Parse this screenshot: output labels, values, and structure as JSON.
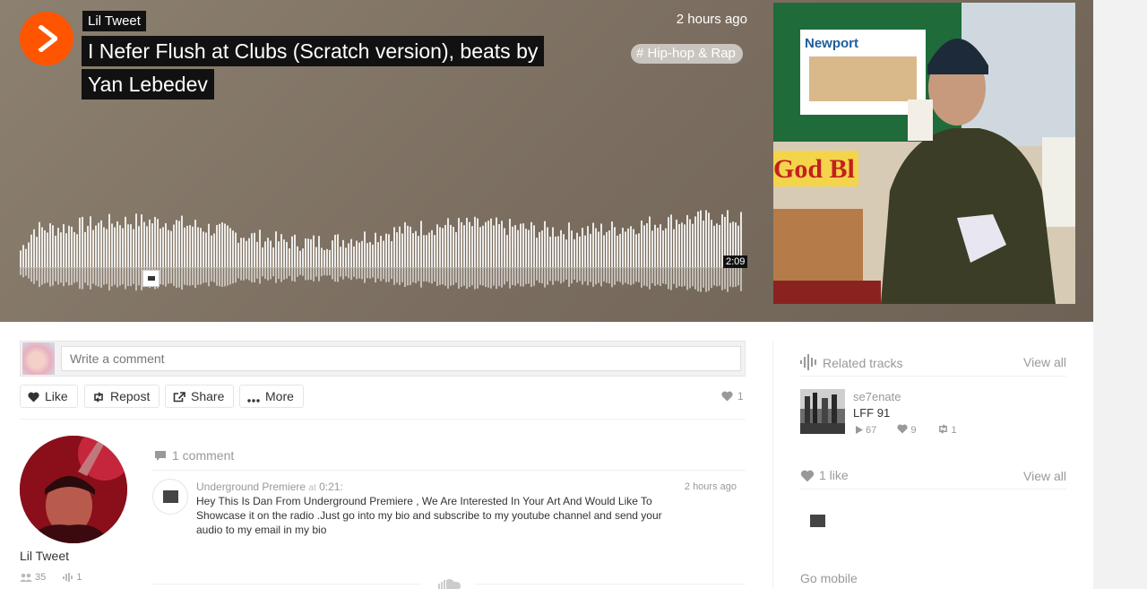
{
  "track": {
    "artist": "Lil Tweet",
    "title_line1": "I Nefer Flush at Clubs (Scratch version), beats by",
    "title_line2": "Yan Lebedev",
    "posted": "2 hours ago",
    "genre": "# Hip-hop & Rap",
    "duration": "2:09"
  },
  "colors": {
    "accent": "#ff5500",
    "hero_bg": "#7d7062"
  },
  "comment_form": {
    "placeholder": "Write a comment"
  },
  "actions": {
    "like": "Like",
    "repost": "Repost",
    "share": "Share",
    "more": "More",
    "like_count": "1"
  },
  "artist": {
    "name": "Lil Tweet",
    "followers": "35",
    "tracks": "1"
  },
  "comments": {
    "count_label": "1 comment",
    "items": [
      {
        "user": "Underground Premiere",
        "at_label": "at",
        "timestamp": "0:21:",
        "posted": "2 hours ago",
        "body": "Hey This Is Dan From Underground Premiere , We Are Interested In Your Art And Would Like To Showcase it on the radio .Just go into my bio and subscribe to my youtube channel and send your audio to my email in my bio"
      }
    ]
  },
  "sidebar": {
    "related_header": "Related tracks",
    "view_all": "View all",
    "related": [
      {
        "user": "se7enate",
        "title": "LFF 91",
        "plays": "67",
        "likes": "9",
        "reposts": "1"
      }
    ],
    "likes_header": "1 like",
    "go_mobile": "Go mobile"
  },
  "icons": [
    "play-icon",
    "heart-icon",
    "repost-icon",
    "share-icon",
    "more-icon",
    "comment-icon",
    "followers-icon",
    "tracks-icon",
    "waveform-icon",
    "soundcloud-icon"
  ]
}
